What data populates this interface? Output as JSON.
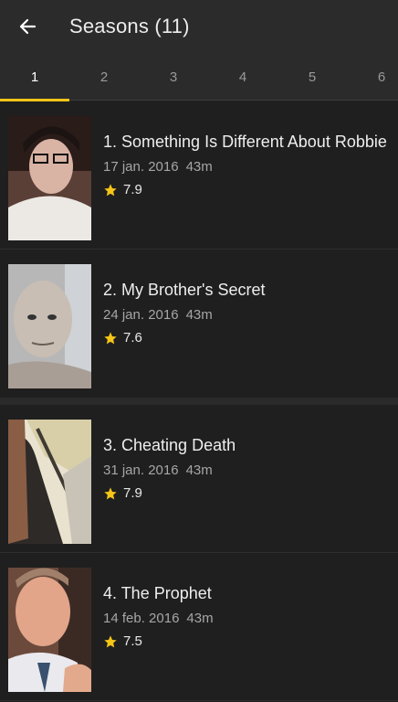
{
  "header": {
    "title": "Seasons (11)",
    "back_icon": "arrow-left-icon"
  },
  "tabs": [
    {
      "label": "1",
      "active": true
    },
    {
      "label": "2",
      "active": false
    },
    {
      "label": "3",
      "active": false
    },
    {
      "label": "4",
      "active": false
    },
    {
      "label": "5",
      "active": false
    },
    {
      "label": "6",
      "active": false
    }
  ],
  "colors": {
    "accent": "#f5c518",
    "background": "#202020",
    "appbar": "#2b2b2b"
  },
  "episodes": [
    {
      "title": "1. Something Is Different About Robbie",
      "date": "17 jan. 2016",
      "duration": "43m",
      "rating": "7.9"
    },
    {
      "title": "2. My Brother's Secret",
      "date": "24 jan. 2016",
      "duration": "43m",
      "rating": "7.6"
    },
    {
      "title": "3. Cheating Death",
      "date": "31 jan. 2016",
      "duration": "43m",
      "rating": "7.9"
    },
    {
      "title": "4. The Prophet",
      "date": "14 feb. 2016",
      "duration": "43m",
      "rating": "7.5"
    }
  ]
}
